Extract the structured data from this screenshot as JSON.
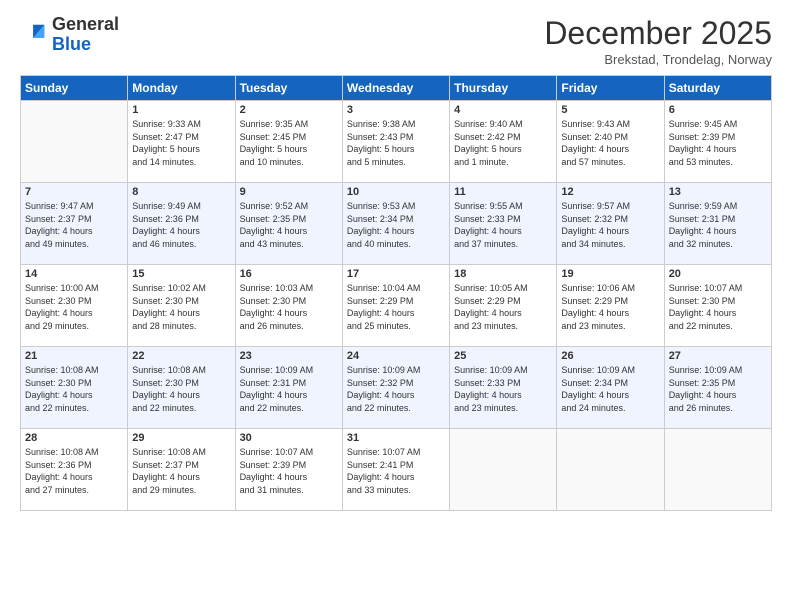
{
  "logo": {
    "general": "General",
    "blue": "Blue"
  },
  "title": "December 2025",
  "subtitle": "Brekstad, Trondelag, Norway",
  "days_header": [
    "Sunday",
    "Monday",
    "Tuesday",
    "Wednesday",
    "Thursday",
    "Friday",
    "Saturday"
  ],
  "weeks": [
    [
      {
        "num": "",
        "info": ""
      },
      {
        "num": "1",
        "info": "Sunrise: 9:33 AM\nSunset: 2:47 PM\nDaylight: 5 hours\nand 14 minutes."
      },
      {
        "num": "2",
        "info": "Sunrise: 9:35 AM\nSunset: 2:45 PM\nDaylight: 5 hours\nand 10 minutes."
      },
      {
        "num": "3",
        "info": "Sunrise: 9:38 AM\nSunset: 2:43 PM\nDaylight: 5 hours\nand 5 minutes."
      },
      {
        "num": "4",
        "info": "Sunrise: 9:40 AM\nSunset: 2:42 PM\nDaylight: 5 hours\nand 1 minute."
      },
      {
        "num": "5",
        "info": "Sunrise: 9:43 AM\nSunset: 2:40 PM\nDaylight: 4 hours\nand 57 minutes."
      },
      {
        "num": "6",
        "info": "Sunrise: 9:45 AM\nSunset: 2:39 PM\nDaylight: 4 hours\nand 53 minutes."
      }
    ],
    [
      {
        "num": "7",
        "info": "Sunrise: 9:47 AM\nSunset: 2:37 PM\nDaylight: 4 hours\nand 49 minutes."
      },
      {
        "num": "8",
        "info": "Sunrise: 9:49 AM\nSunset: 2:36 PM\nDaylight: 4 hours\nand 46 minutes."
      },
      {
        "num": "9",
        "info": "Sunrise: 9:52 AM\nSunset: 2:35 PM\nDaylight: 4 hours\nand 43 minutes."
      },
      {
        "num": "10",
        "info": "Sunrise: 9:53 AM\nSunset: 2:34 PM\nDaylight: 4 hours\nand 40 minutes."
      },
      {
        "num": "11",
        "info": "Sunrise: 9:55 AM\nSunset: 2:33 PM\nDaylight: 4 hours\nand 37 minutes."
      },
      {
        "num": "12",
        "info": "Sunrise: 9:57 AM\nSunset: 2:32 PM\nDaylight: 4 hours\nand 34 minutes."
      },
      {
        "num": "13",
        "info": "Sunrise: 9:59 AM\nSunset: 2:31 PM\nDaylight: 4 hours\nand 32 minutes."
      }
    ],
    [
      {
        "num": "14",
        "info": "Sunrise: 10:00 AM\nSunset: 2:30 PM\nDaylight: 4 hours\nand 29 minutes."
      },
      {
        "num": "15",
        "info": "Sunrise: 10:02 AM\nSunset: 2:30 PM\nDaylight: 4 hours\nand 28 minutes."
      },
      {
        "num": "16",
        "info": "Sunrise: 10:03 AM\nSunset: 2:30 PM\nDaylight: 4 hours\nand 26 minutes."
      },
      {
        "num": "17",
        "info": "Sunrise: 10:04 AM\nSunset: 2:29 PM\nDaylight: 4 hours\nand 25 minutes."
      },
      {
        "num": "18",
        "info": "Sunrise: 10:05 AM\nSunset: 2:29 PM\nDaylight: 4 hours\nand 23 minutes."
      },
      {
        "num": "19",
        "info": "Sunrise: 10:06 AM\nSunset: 2:29 PM\nDaylight: 4 hours\nand 23 minutes."
      },
      {
        "num": "20",
        "info": "Sunrise: 10:07 AM\nSunset: 2:30 PM\nDaylight: 4 hours\nand 22 minutes."
      }
    ],
    [
      {
        "num": "21",
        "info": "Sunrise: 10:08 AM\nSunset: 2:30 PM\nDaylight: 4 hours\nand 22 minutes."
      },
      {
        "num": "22",
        "info": "Sunrise: 10:08 AM\nSunset: 2:30 PM\nDaylight: 4 hours\nand 22 minutes."
      },
      {
        "num": "23",
        "info": "Sunrise: 10:09 AM\nSunset: 2:31 PM\nDaylight: 4 hours\nand 22 minutes."
      },
      {
        "num": "24",
        "info": "Sunrise: 10:09 AM\nSunset: 2:32 PM\nDaylight: 4 hours\nand 22 minutes."
      },
      {
        "num": "25",
        "info": "Sunrise: 10:09 AM\nSunset: 2:33 PM\nDaylight: 4 hours\nand 23 minutes."
      },
      {
        "num": "26",
        "info": "Sunrise: 10:09 AM\nSunset: 2:34 PM\nDaylight: 4 hours\nand 24 minutes."
      },
      {
        "num": "27",
        "info": "Sunrise: 10:09 AM\nSunset: 2:35 PM\nDaylight: 4 hours\nand 26 minutes."
      }
    ],
    [
      {
        "num": "28",
        "info": "Sunrise: 10:08 AM\nSunset: 2:36 PM\nDaylight: 4 hours\nand 27 minutes."
      },
      {
        "num": "29",
        "info": "Sunrise: 10:08 AM\nSunset: 2:37 PM\nDaylight: 4 hours\nand 29 minutes."
      },
      {
        "num": "30",
        "info": "Sunrise: 10:07 AM\nSunset: 2:39 PM\nDaylight: 4 hours\nand 31 minutes."
      },
      {
        "num": "31",
        "info": "Sunrise: 10:07 AM\nSunset: 2:41 PM\nDaylight: 4 hours\nand 33 minutes."
      },
      {
        "num": "",
        "info": ""
      },
      {
        "num": "",
        "info": ""
      },
      {
        "num": "",
        "info": ""
      }
    ]
  ]
}
